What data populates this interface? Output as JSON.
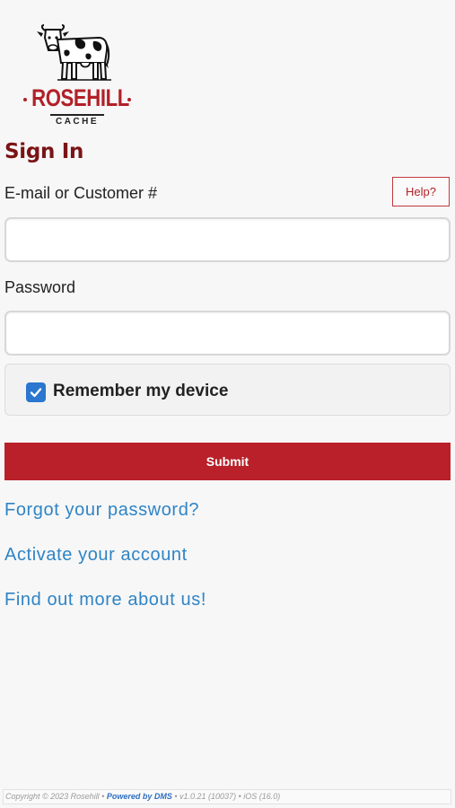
{
  "brand": {
    "name": "ROSEHILL",
    "subname": "CACHE",
    "logo_icon": "cow-icon",
    "colors": {
      "brand_red": "#b22028",
      "title_red": "#7a1416",
      "link_blue": "#2f84c5",
      "checkbox_blue": "#2b76cf"
    }
  },
  "form": {
    "title": "Sign In",
    "email_label": "E-mail or Customer #",
    "email_value": "",
    "email_placeholder": "",
    "help_label": "Help?",
    "password_label": "Password",
    "password_value": "",
    "password_placeholder": "",
    "remember_label": "Remember my device",
    "remember_checked": true,
    "submit_label": "Submit"
  },
  "links": {
    "forgot": "Forgot your password?",
    "activate": "Activate your account",
    "about": "Find out more about us!"
  },
  "footer": {
    "copyright": "Copyright © 2023 Rosehill",
    "sep1": " • ",
    "powered": "Powered by DMS",
    "sep2": " • ",
    "version": "v1.0.21 (10037)",
    "sep3": " • ",
    "platform": "iOS (16.0)"
  }
}
